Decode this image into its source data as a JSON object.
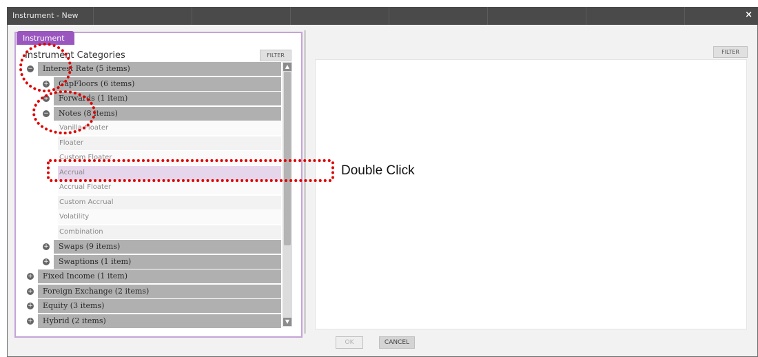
{
  "window": {
    "title": "Instrument - New",
    "close_glyph": "×"
  },
  "left": {
    "tab_label": "Instrument",
    "categories_title": "Instrument Categories",
    "filter_label": "FILTER",
    "tree": [
      {
        "label": "Interest Rate (5 items)",
        "kind": "group",
        "level": 0,
        "expander": "−"
      },
      {
        "label": "CapFloors (6 items)",
        "kind": "group",
        "level": 1,
        "expander": "+"
      },
      {
        "label": "Forwards (1 item)",
        "kind": "group",
        "level": 1,
        "expander": "+"
      },
      {
        "label": "Notes (8 items)",
        "kind": "group",
        "level": 1,
        "expander": "−"
      },
      {
        "label": "Vanilla Floater",
        "kind": "leaf"
      },
      {
        "label": "Floater",
        "kind": "leaf"
      },
      {
        "label": "Custom Floater",
        "kind": "leaf"
      },
      {
        "label": "Accrual",
        "kind": "leaf",
        "selected": true
      },
      {
        "label": "Accrual Floater",
        "kind": "leaf"
      },
      {
        "label": "Custom Accrual",
        "kind": "leaf"
      },
      {
        "label": "Volatility",
        "kind": "leaf"
      },
      {
        "label": "Combination",
        "kind": "leaf"
      },
      {
        "label": "Swaps (9 items)",
        "kind": "group",
        "level": 1,
        "expander": "+"
      },
      {
        "label": "Swaptions (1 item)",
        "kind": "group",
        "level": 1,
        "expander": "+"
      },
      {
        "label": "Fixed Income (1 item)",
        "kind": "group",
        "level": 0,
        "expander": "+"
      },
      {
        "label": "Foreign Exchange (2 items)",
        "kind": "group",
        "level": 0,
        "expander": "+"
      },
      {
        "label": "Equity (3 items)",
        "kind": "group",
        "level": 0,
        "expander": "+"
      },
      {
        "label": "Hybrid (2 items)",
        "kind": "group",
        "level": 0,
        "expander": "+"
      }
    ]
  },
  "right": {
    "filter_label": "FILTER"
  },
  "footer": {
    "ok_label": "OK",
    "cancel_label": "CANCEL"
  },
  "annotation": {
    "text": "Double Click",
    "marker_color": "#e00000"
  },
  "colors": {
    "tab": "#9a56bf",
    "group_row": "#b0b0b0",
    "selected_row": "#e6d6ec",
    "titlebar": "#4a4a4a"
  }
}
